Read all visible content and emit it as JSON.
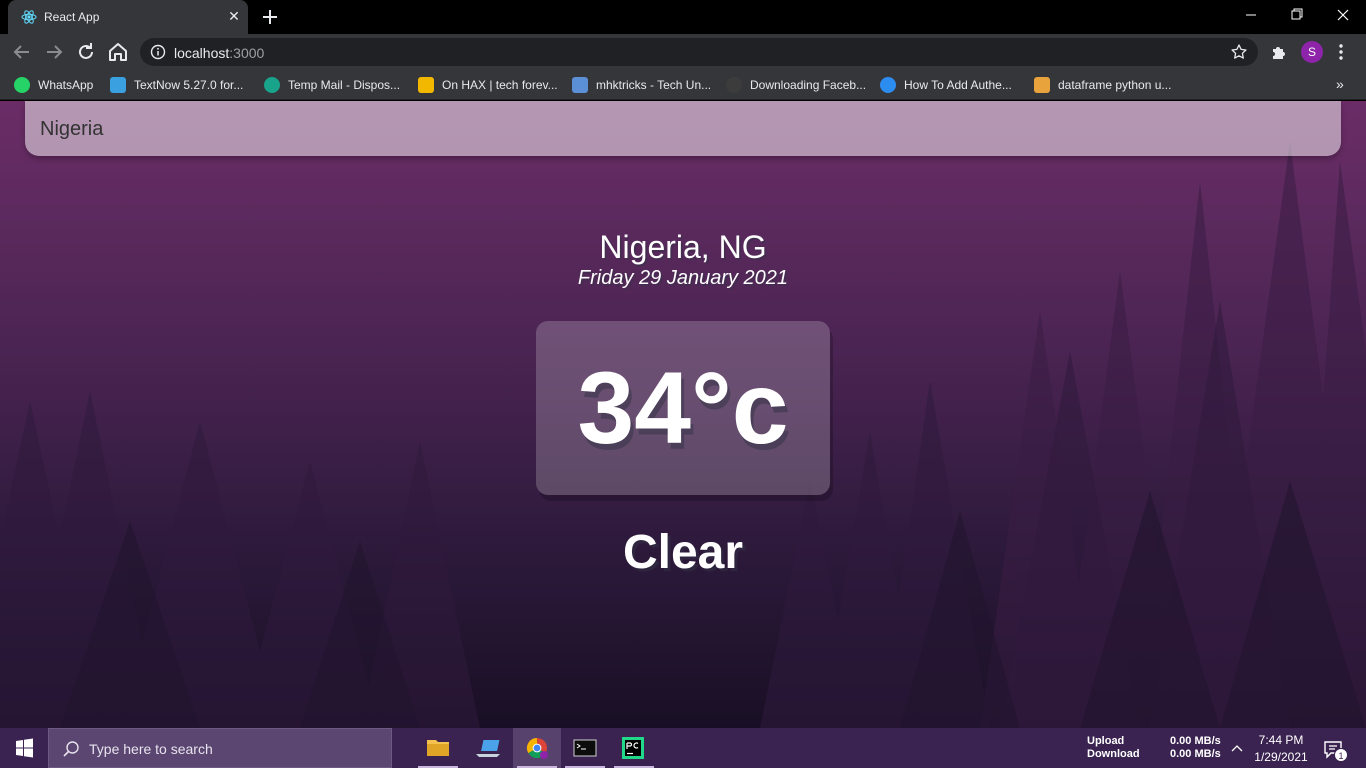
{
  "browser": {
    "tab": {
      "title": "React App",
      "close": "✕",
      "favicon": "react-icon"
    },
    "new_tab": "+",
    "url_host": "localhost",
    "url_port": ":3000",
    "profile_initial": "S",
    "bookmarks_overflow": "»",
    "bookmarks": [
      {
        "label": "WhatsApp",
        "icon": "whatsapp-icon",
        "color": "#25d366"
      },
      {
        "label": "TextNow 5.27.0 for...",
        "icon": "textnow-icon",
        "color": "#3aa0e0"
      },
      {
        "label": "Temp Mail - Dispos...",
        "icon": "tempmail-icon",
        "color": "#19a38a"
      },
      {
        "label": "On HAX | tech forev...",
        "icon": "onhax-icon",
        "color": "#f2b800"
      },
      {
        "label": "mhktricks - Tech Un...",
        "icon": "mhktricks-icon",
        "color": "#5b8fd6"
      },
      {
        "label": "Downloading Faceb...",
        "icon": "page-icon",
        "color": "#3c3c3c"
      },
      {
        "label": "How To Add Authe...",
        "icon": "auth0-icon",
        "color": "#2d8cf0"
      },
      {
        "label": "dataframe python u...",
        "icon": "dataframe-icon",
        "color": "#e8a33d"
      }
    ]
  },
  "app": {
    "search_value": "Nigeria",
    "location": "Nigeria, NG",
    "date": "Friday 29 January 2021",
    "temperature": "34°c",
    "weather": "Clear"
  },
  "taskbar": {
    "search_placeholder": "Type here to search",
    "apps": [
      {
        "name": "file-explorer",
        "icon": "folder-icon"
      },
      {
        "name": "this-pc",
        "icon": "laptop-icon"
      },
      {
        "name": "chrome",
        "icon": "chrome-icon",
        "active": true
      },
      {
        "name": "terminal",
        "icon": "terminal-icon"
      },
      {
        "name": "pycharm",
        "icon": "pycharm-icon"
      }
    ],
    "net_labels": {
      "upload": "Upload",
      "download": "Download"
    },
    "net_values": {
      "upload": "0.00 MB/s",
      "download": "0.00 MB/s"
    },
    "time": "7:44 PM",
    "date": "1/29/2021",
    "notification_count": "1"
  },
  "colors": {
    "page_top": "#6b2c66",
    "page_bottom": "#190f25",
    "taskbar": "#3a2350",
    "browser_chrome": "#35363a"
  }
}
